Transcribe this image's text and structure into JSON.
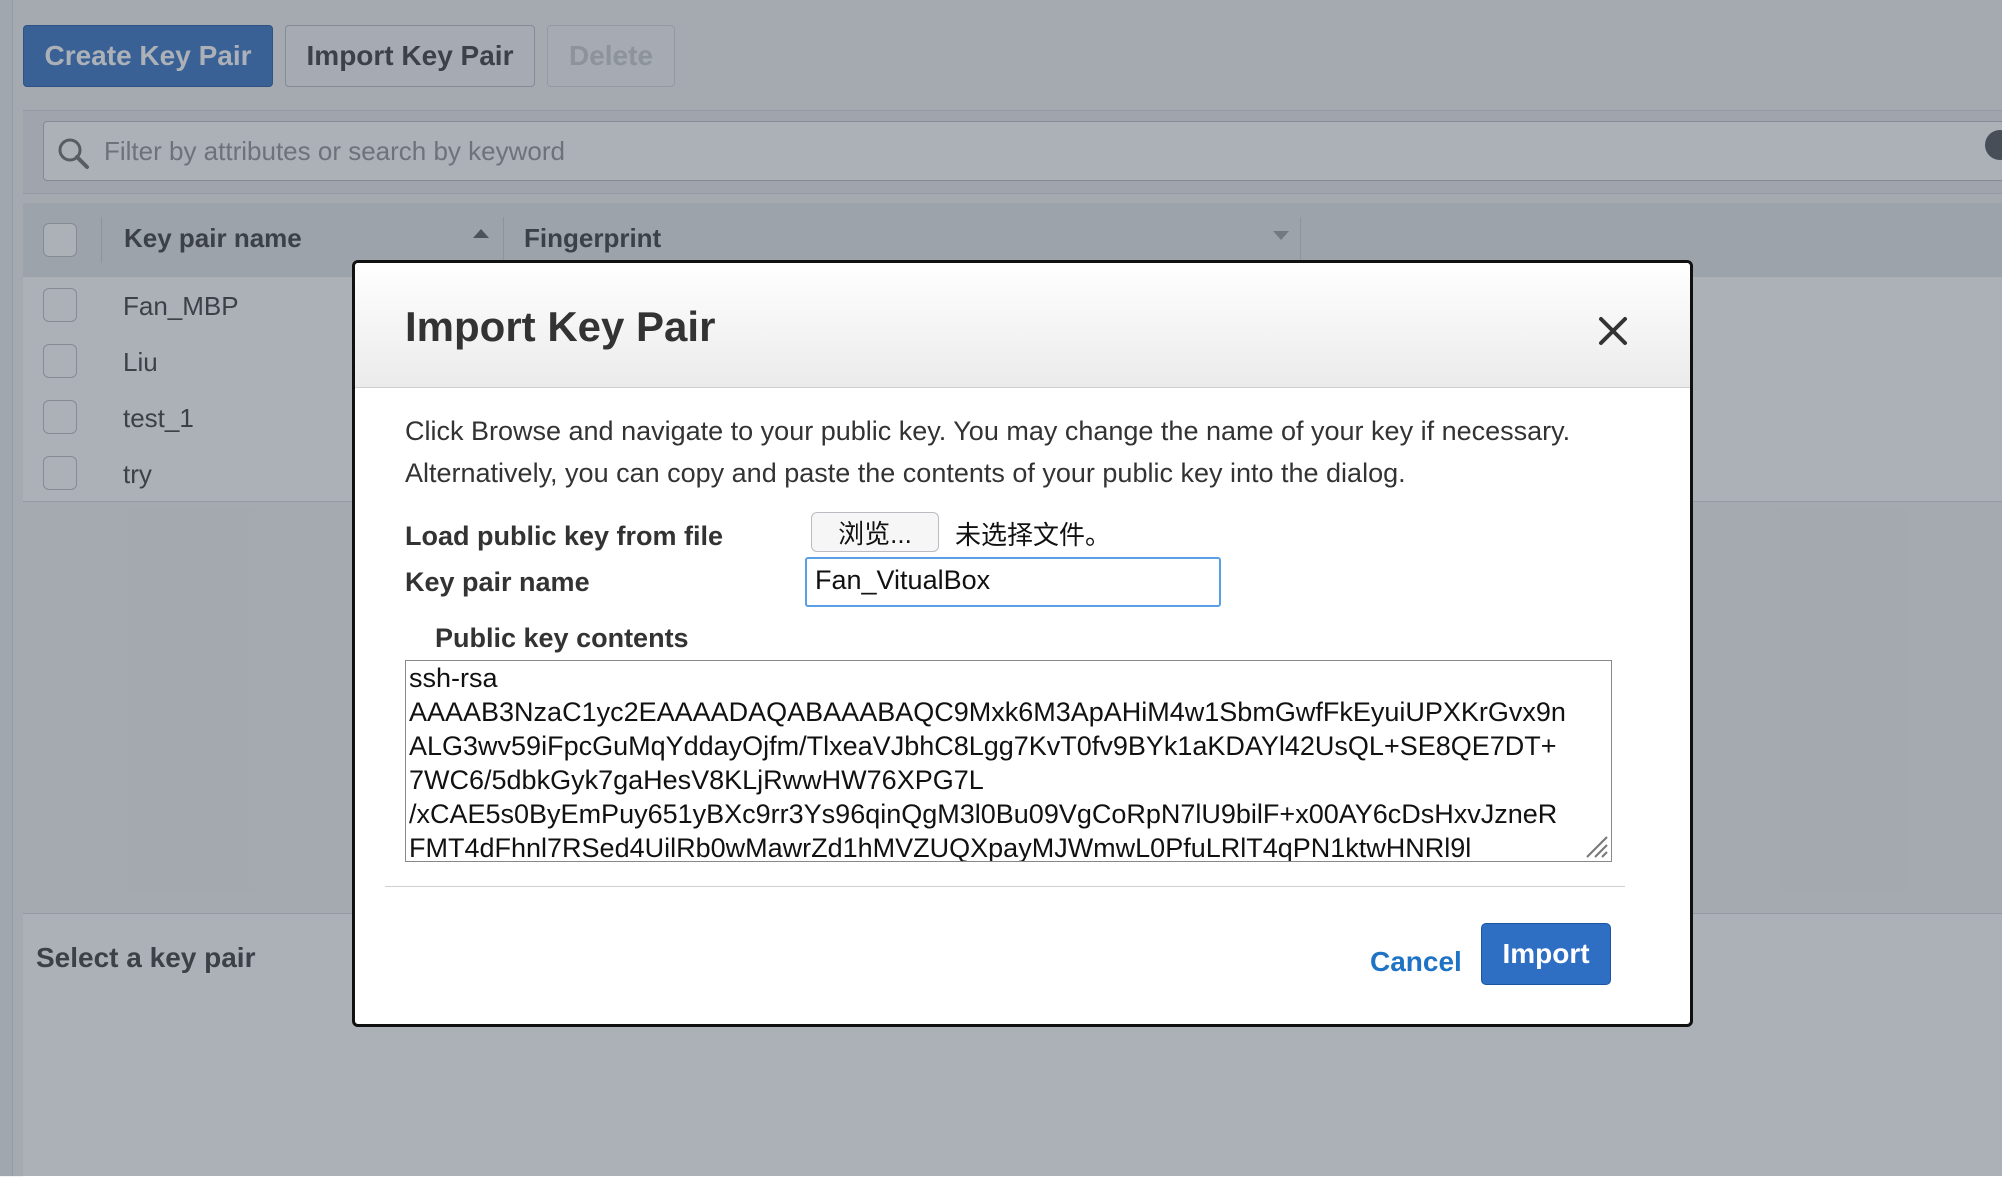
{
  "toolbar": {
    "create_label": "Create Key Pair",
    "import_label": "Import Key Pair",
    "delete_label": "Delete"
  },
  "search": {
    "placeholder": "Filter by attributes or search by keyword"
  },
  "table": {
    "headers": [
      "Key pair name",
      "Fingerprint"
    ],
    "rows": [
      "Fan_MBP",
      "Liu",
      "test_1",
      "try"
    ]
  },
  "detail": {
    "title": "Select a key pair"
  },
  "modal": {
    "title": "Import Key Pair",
    "description": "Click Browse and navigate to your public key. You may change the name of your key if necessary. Alternatively, you can copy and paste the contents of your public key into the dialog.",
    "load_label": "Load public key from file",
    "browse_label": "浏览...",
    "file_status": "未选择文件。",
    "name_label": "Key pair name",
    "name_value": "Fan_VitualBox",
    "contents_label": "Public key contents",
    "contents_value": "ssh-rsa\nAAAAB3NzaC1yc2EAAAADAQABAAABAQC9Mxk6M3ApAHiM4w1SbmGwfFkEyuiUPXKrGvx9n\nALG3wv59iFpcGuMqYddayOjfm/TlxeaVJbhC8Lgg7KvT0fv9BYk1aKDAYl42UsQL+SE8QE7DT+\n7WC6/5dbkGyk7gaHesV8KLjRwwHW76XPG7L\n/xCAE5s0ByEmPuy651yBXc9rr3Ys96qinQgM3l0Bu09VgCoRpN7lU9bilF+x00AY6cDsHxvJzneR\nFMT4dFhnl7RSed4UilRb0wMawrZd1hMVZUQXpayMJWmwL0PfuLRlT4qPN1ktwHNRl9l",
    "cancel_label": "Cancel",
    "import_label": "Import"
  }
}
